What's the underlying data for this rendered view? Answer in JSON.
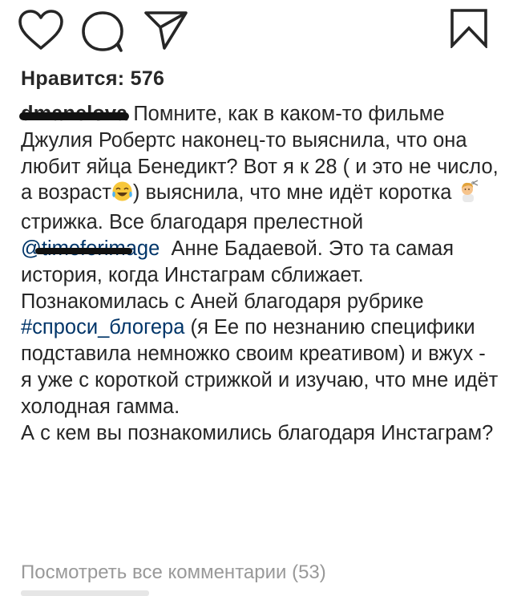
{
  "actions": {
    "like_icon": "heart-outline-icon",
    "comment_icon": "speech-bubble-icon",
    "share_icon": "paper-plane-icon",
    "save_icon": "bookmark-icon"
  },
  "likes": {
    "label": "Нравится: 576"
  },
  "caption": {
    "username": "dmanelova",
    "p1_text": "Помните, как в каком-то фильме Джулия Робертс наконец-то выяснила, что она любит яйца Бенедикт? Вот я к 28 ( и это не число, а возраст",
    "p1_text2": ") выяснила, что мне идёт коротка",
    "p1_text3": "стрижка. Все благодаря прелестной",
    "p1_mention": "@timeforimage",
    "p1_text4": "Анне Бадаевой. Это та самая история, когда Инстаграм сближает.",
    "p2_text": "Познакомилась с Аней благодаря рубрике",
    "p2_hashtag": "#спроси_блогера",
    "p2_text2": "(я Ее  по незнанию специфики подставила немножко своим креативом) и вжух - я уже с короткой стрижкой и изучаю, что мне идёт холодная гамма.",
    "p3_text": "А с кем вы познакомились благодаря Инстаграм?"
  },
  "comments": {
    "view_all": "Посмотреть все комментарии (53)"
  },
  "colors": {
    "text": "#262626",
    "link": "#003569",
    "muted": "#999999"
  }
}
